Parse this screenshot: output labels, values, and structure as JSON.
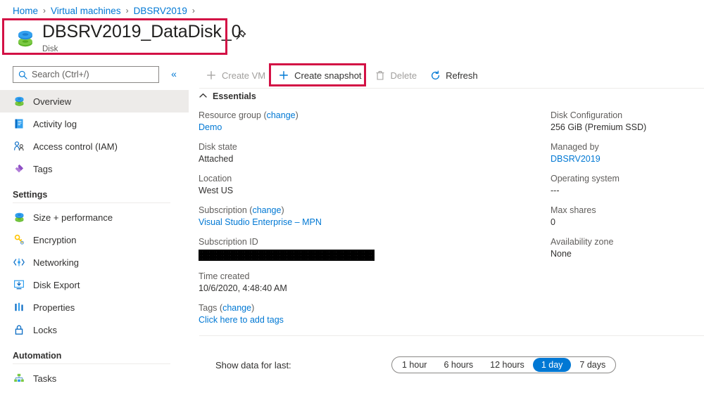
{
  "breadcrumb": {
    "items": [
      {
        "label": "Home"
      },
      {
        "label": "Virtual machines"
      },
      {
        "label": "DBSRV2019"
      }
    ],
    "separator": "›"
  },
  "header": {
    "title": "DBSRV2019_DataDisk_0",
    "subtitle": "Disk",
    "resource_icon": "disk-icon",
    "pin_icon": "pin-icon"
  },
  "sidebar": {
    "search": {
      "placeholder": "Search (Ctrl+/)",
      "value": "",
      "icon": "search-icon"
    },
    "collapse_icon": "«",
    "items": [
      {
        "label": "Overview",
        "icon": "disk-icon",
        "selected": true
      },
      {
        "label": "Activity log",
        "icon": "activity-log-icon",
        "selected": false
      },
      {
        "label": "Access control (IAM)",
        "icon": "access-control-icon",
        "selected": false
      },
      {
        "label": "Tags",
        "icon": "tag-icon",
        "selected": false
      }
    ],
    "sections": [
      {
        "title": "Settings",
        "items": [
          {
            "label": "Size + performance",
            "icon": "disk-icon"
          },
          {
            "label": "Encryption",
            "icon": "key-icon"
          },
          {
            "label": "Networking",
            "icon": "networking-icon"
          },
          {
            "label": "Disk Export",
            "icon": "disk-export-icon"
          },
          {
            "label": "Properties",
            "icon": "properties-icon"
          },
          {
            "label": "Locks",
            "icon": "lock-icon"
          }
        ]
      },
      {
        "title": "Automation",
        "items": [
          {
            "label": "Tasks",
            "icon": "tasks-icon"
          }
        ]
      }
    ]
  },
  "toolbar": {
    "create_vm": {
      "label": "Create VM",
      "icon": "plus-icon",
      "disabled": true
    },
    "create_snapshot": {
      "label": "Create snapshot",
      "icon": "plus-icon",
      "disabled": false
    },
    "delete": {
      "label": "Delete",
      "icon": "trash-icon",
      "disabled": true
    },
    "refresh": {
      "label": "Refresh",
      "icon": "refresh-icon",
      "disabled": false
    }
  },
  "essentials": {
    "header": "Essentials",
    "collapse_chevron": "⌃",
    "left": [
      {
        "label": "Resource group",
        "label_action": "change",
        "value": "Demo",
        "value_is_link": true
      },
      {
        "label": "Disk state",
        "value": "Attached",
        "value_is_link": false
      },
      {
        "label": "Location",
        "value": "West US",
        "value_is_link": false
      },
      {
        "label": "Subscription",
        "label_action": "change",
        "value": "Visual Studio Enterprise – MPN",
        "value_is_link": true
      },
      {
        "label": "Subscription ID",
        "value": "",
        "redacted": true
      },
      {
        "label": "Time created",
        "value": "10/6/2020, 4:48:40 AM",
        "value_is_link": false
      },
      {
        "label": "Tags",
        "label_action": "change",
        "value": "Click here to add tags",
        "value_is_link": true
      }
    ],
    "right": [
      {
        "label": "Disk Configuration",
        "value": "256 GiB (Premium SSD)",
        "value_is_link": false
      },
      {
        "label": "Managed by",
        "value": "DBSRV2019",
        "value_is_link": true
      },
      {
        "label": "Operating system",
        "value": "---",
        "value_is_link": false
      },
      {
        "label": "Max shares",
        "value": "0",
        "value_is_link": false
      },
      {
        "label": "Availability zone",
        "value": "None",
        "value_is_link": false
      }
    ]
  },
  "timerange": {
    "label": "Show data for last:",
    "options": [
      {
        "label": "1 hour",
        "active": false
      },
      {
        "label": "6 hours",
        "active": false
      },
      {
        "label": "12 hours",
        "active": false
      },
      {
        "label": "1 day",
        "active": true
      },
      {
        "label": "7 days",
        "active": false
      }
    ]
  },
  "annotations": {
    "highlight_color": "#d31145",
    "boxes": [
      "title-highlight",
      "create-snapshot-highlight"
    ]
  },
  "colors": {
    "accent": "#0078d4",
    "link": "#0078d4",
    "text": "#323130",
    "muted": "#605e5c",
    "selected_bg": "#edebe9",
    "annotation": "#d31145"
  }
}
